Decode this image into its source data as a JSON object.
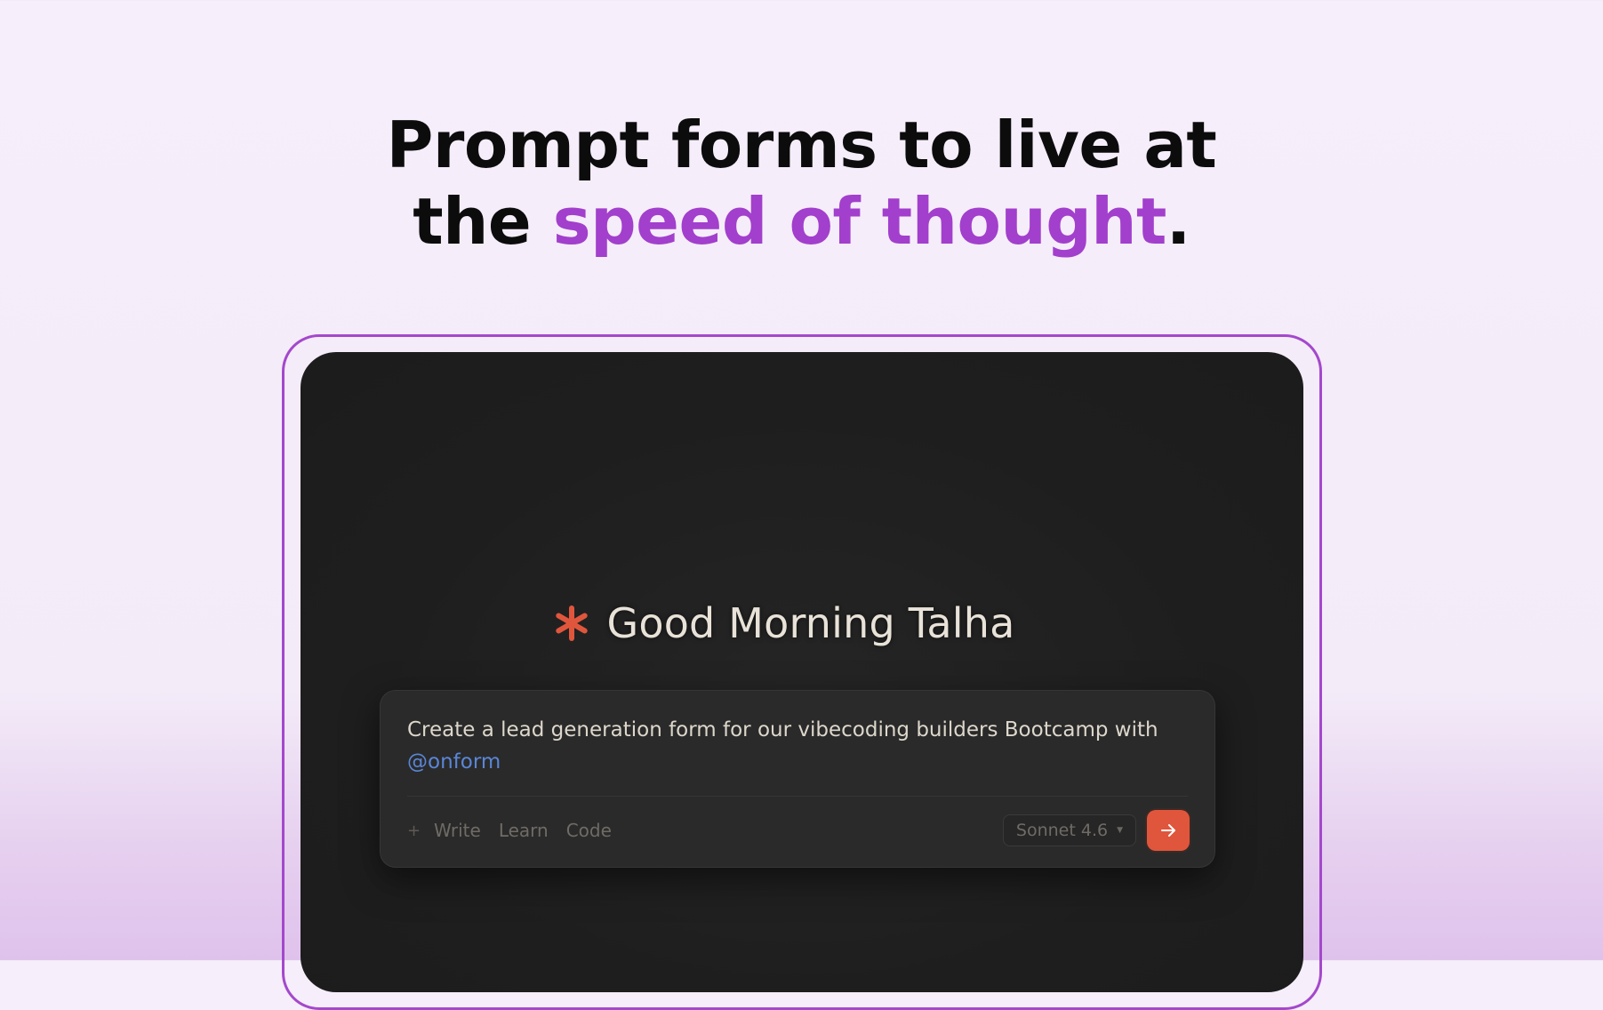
{
  "headline": {
    "line1": "Prompt forms to live at",
    "line2_prefix": "the ",
    "line2_accent": "speed of thought",
    "line2_suffix": "."
  },
  "app": {
    "greeting": "Good Morning Talha",
    "composer": {
      "prompt_text": "Create a lead generation form for our vibecoding builders Bootcamp with",
      "mention": "@onform",
      "actions": [
        "Write",
        "Learn",
        "Code"
      ],
      "model": "Sonnet 4.6"
    }
  },
  "icons": {
    "logo": "asterisk-icon",
    "add": "plus-icon",
    "model_dropdown": "caret-down-icon",
    "send": "arrow-right-icon"
  },
  "colors": {
    "accent_purple": "#a23fcc",
    "frame_border": "#a448cc",
    "brand_orange": "#e0563c",
    "mention_blue": "#5a86d6",
    "app_background": "#1e1e1e"
  }
}
